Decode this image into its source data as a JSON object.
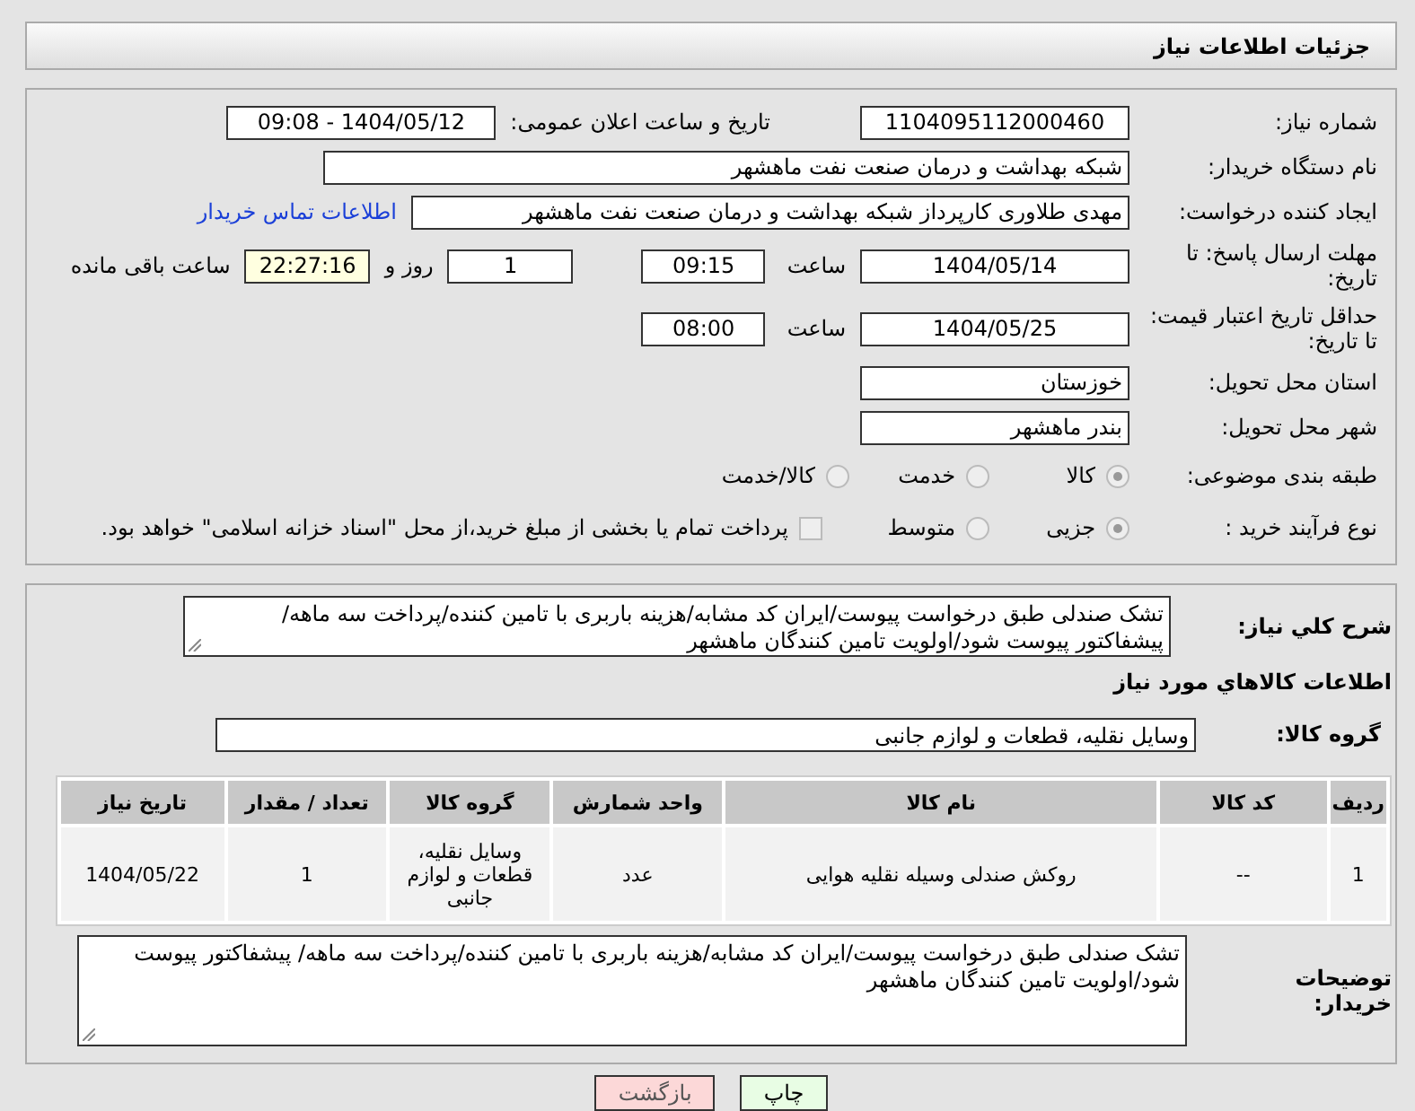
{
  "header": {
    "title": "جزئیات اطلاعات نیاز"
  },
  "need_number": {
    "label": "شماره نیاز:",
    "value": "1104095112000460"
  },
  "announce": {
    "label": "تاریخ و ساعت اعلان عمومی:",
    "value": "1404/05/12 - 09:08"
  },
  "buyer_org": {
    "label": "نام دستگاه خریدار:",
    "value": "شبکه بهداشت و درمان صنعت نفت ماهشهر"
  },
  "creator": {
    "label": "ایجاد کننده درخواست:",
    "value": "مهدی طلاوری کارپرداز شبکه بهداشت و درمان صنعت نفت ماهشهر",
    "link": "اطلاعات تماس خریدار"
  },
  "reply_deadline": {
    "label": "مهلت ارسال پاسخ: تا تاریخ:",
    "date": "1404/05/14",
    "time_label": "ساعت",
    "time": "09:15",
    "days": "1",
    "days_label": "روز و",
    "remaining": "22:27:16",
    "remaining_label": "ساعت باقی مانده"
  },
  "price_validity": {
    "label": "حداقل تاریخ اعتبار قیمت: تا تاریخ:",
    "date": "1404/05/25",
    "time_label": "ساعت",
    "time": "08:00"
  },
  "province": {
    "label": "استان محل تحویل:",
    "value": "خوزستان"
  },
  "city": {
    "label": "شهر محل تحویل:",
    "value": "بندر ماهشهر"
  },
  "category": {
    "label": "طبقه بندی موضوعی:",
    "options": [
      {
        "label": "کالا",
        "selected": true
      },
      {
        "label": "خدمت",
        "selected": false
      },
      {
        "label": "کالا/خدمت",
        "selected": false
      }
    ]
  },
  "process": {
    "label": "نوع فرآیند خرید :",
    "options": [
      {
        "label": "جزیی",
        "selected": true
      },
      {
        "label": "متوسط",
        "selected": false
      }
    ],
    "checkbox": {
      "label": "پرداخت تمام یا بخشی از مبلغ خرید،از محل \"اسناد خزانه اسلامی\" خواهد بود.",
      "checked": false
    }
  },
  "description": {
    "label": "شرح کلي نياز:",
    "value": "تشک صندلی طبق درخواست پیوست/ایران کد مشابه/هزینه باربری با تامین کننده/پرداخت سه ماهه/ پیشفاکتور پیوست شود/اولویت تامین کنندگان ماهشهر"
  },
  "goods_title": "اطلاعات کالاهاي مورد نياز",
  "goods_group": {
    "label": "گروه کالا:",
    "value": "وسایل نقلیه، قطعات و لوازم جانبی"
  },
  "table": {
    "columns": [
      "ردیف",
      "کد کالا",
      "نام کالا",
      "واحد شمارش",
      "گروه کالا",
      "تعداد / مقدار",
      "تاریخ نیاز"
    ],
    "rows": [
      [
        "1",
        "--",
        "روکش صندلی وسیله نقلیه هوایی",
        "عدد",
        "وسایل نقلیه، قطعات و لوازم جانبی",
        "1",
        "1404/05/22"
      ]
    ]
  },
  "buyer_notes": {
    "label": "توضیحات خریدار:",
    "value": "تشک صندلی طبق درخواست پیوست/ایران کد مشابه/هزینه باربری با تامین کننده/پرداخت سه ماهه/ پیشفاکتور پیوست شود/اولویت تامین کنندگان ماهشهر"
  },
  "buttons": [
    {
      "label": "چاپ",
      "kind": "print"
    },
    {
      "label": "بازگشت",
      "kind": "back"
    }
  ]
}
